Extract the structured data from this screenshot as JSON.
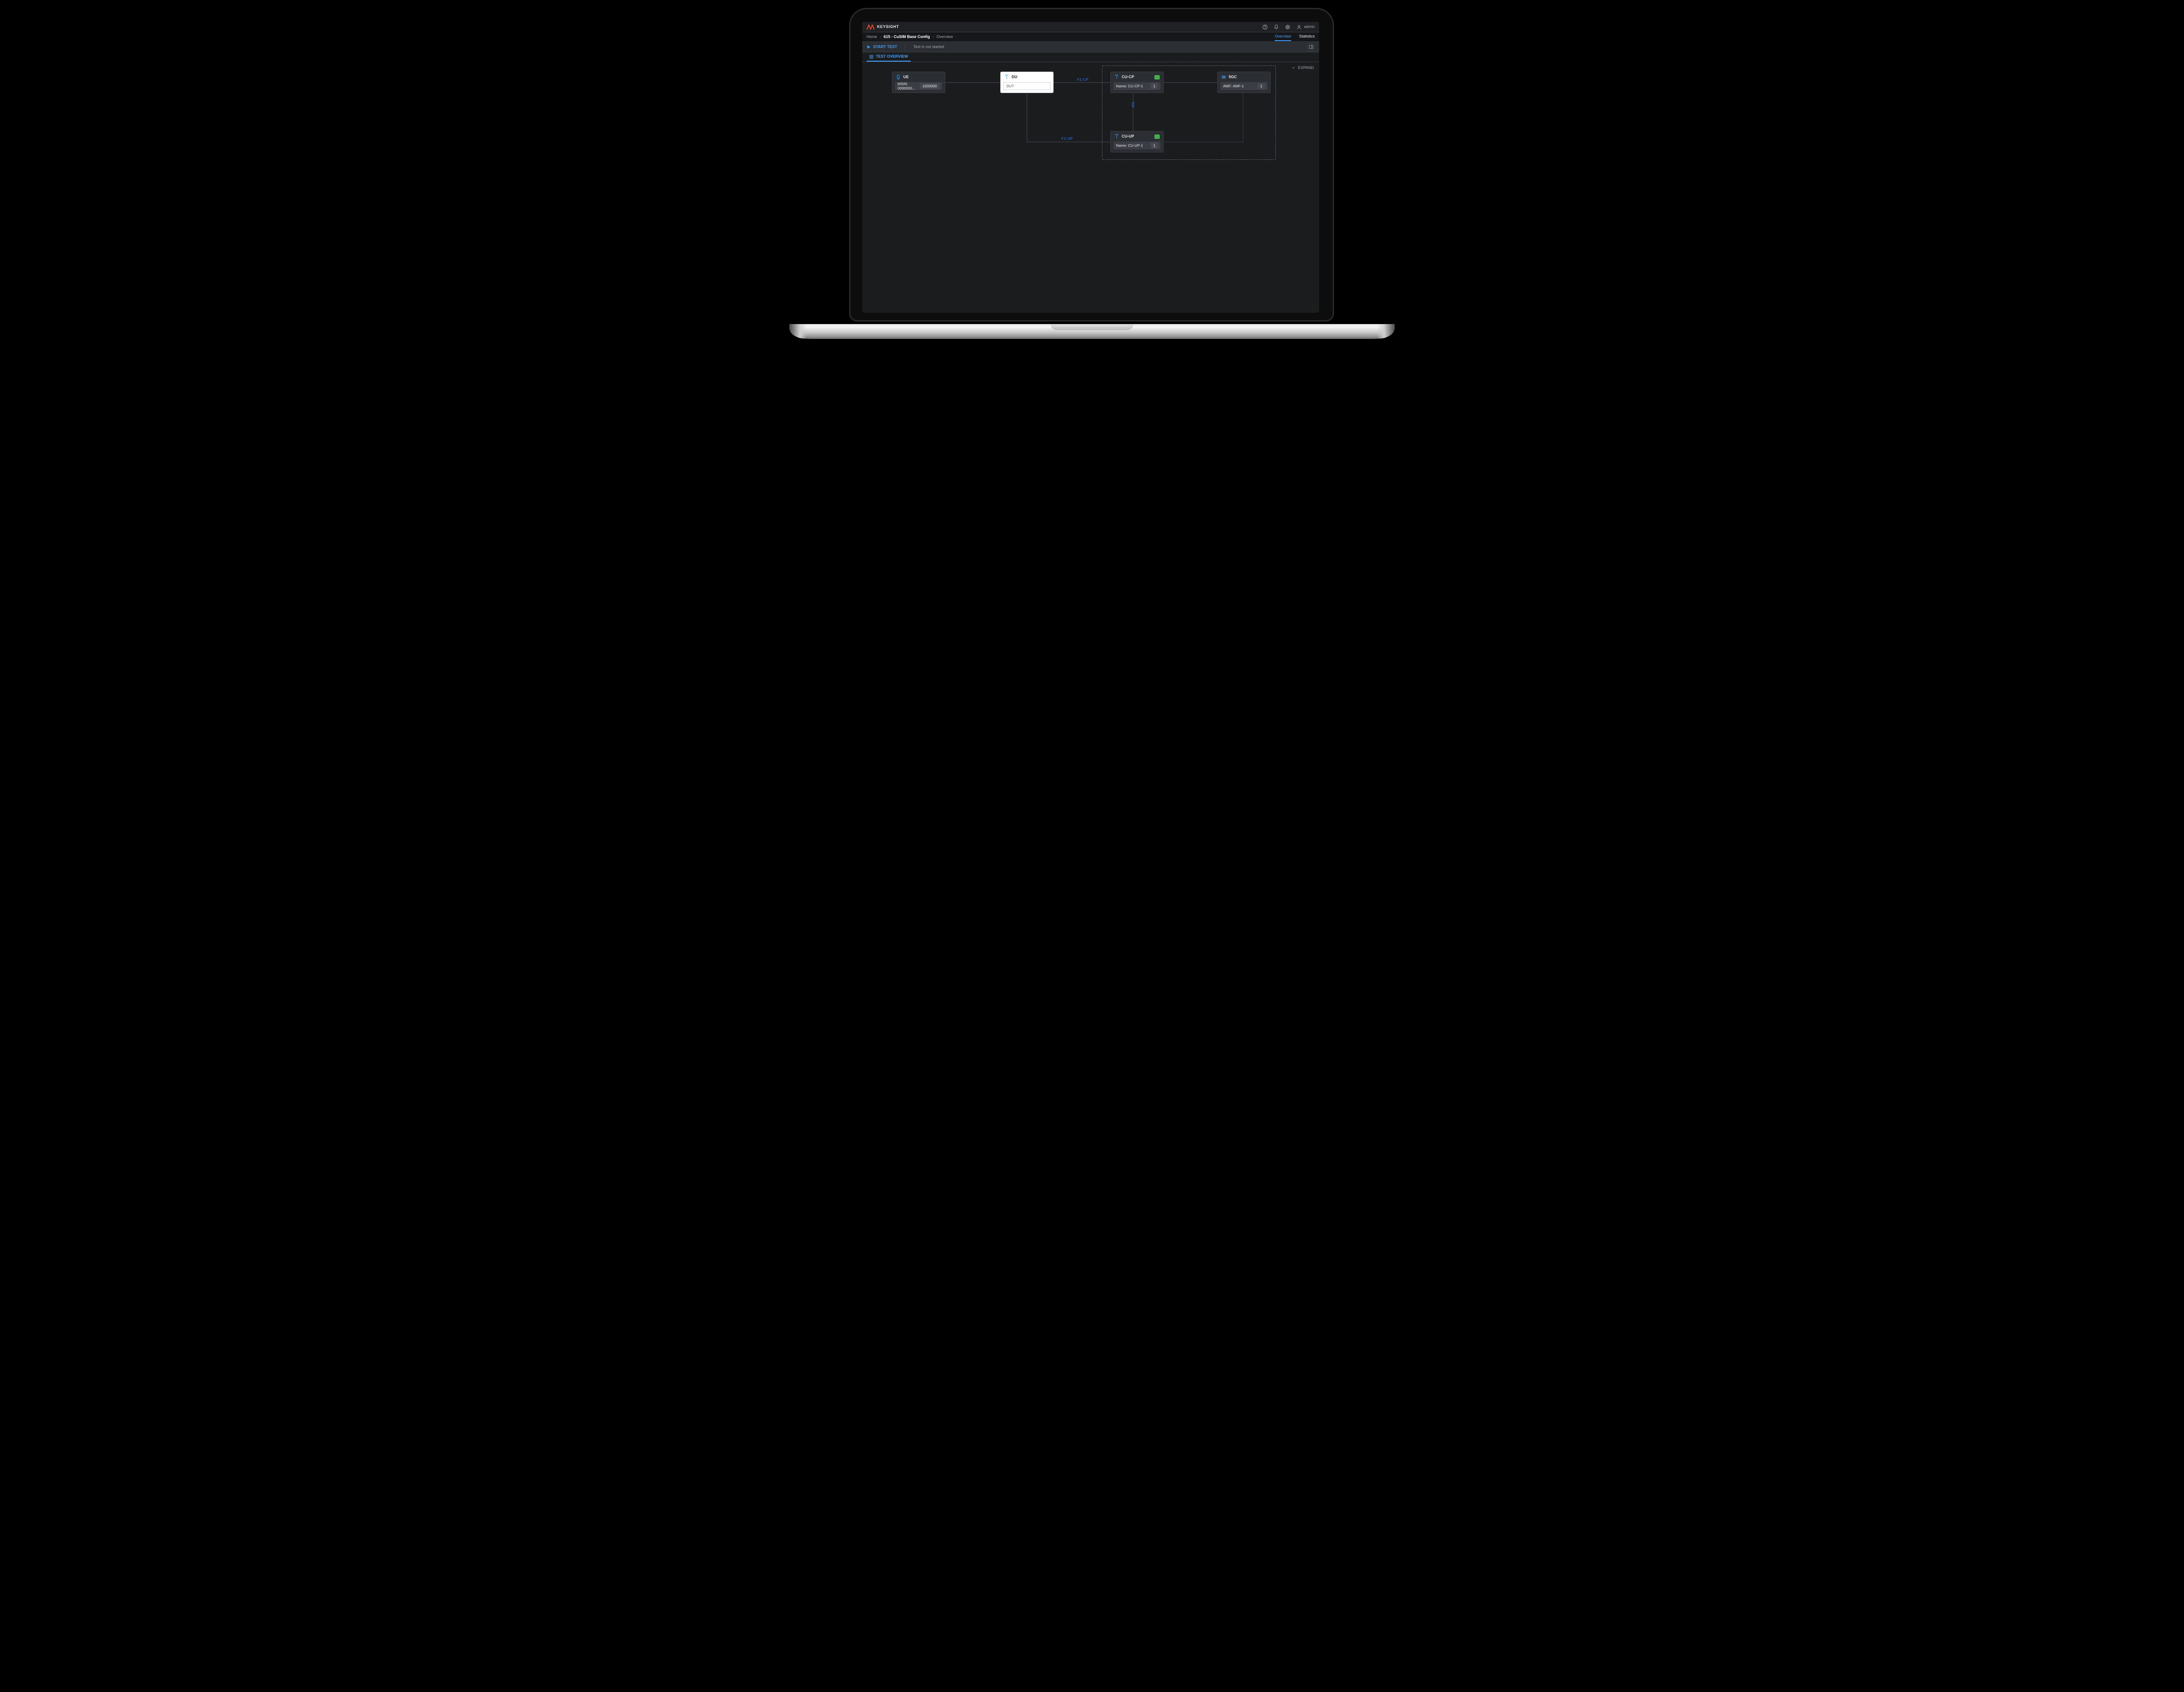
{
  "brand": {
    "name": "KEYSIGHT"
  },
  "header": {
    "icons": {
      "help": "?",
      "notifications": "bell",
      "settings": "gear",
      "user": "user"
    },
    "username": "admin"
  },
  "breadcrumb": {
    "home": "Home",
    "config": "615 - CuSIM Base Config",
    "page": "Overview"
  },
  "navTabs": {
    "overview": "Overview",
    "statistics": "Statistics",
    "active": "overview"
  },
  "toolbar": {
    "start": "START TEST",
    "status": "Test is not started"
  },
  "subtab": {
    "label": "TEST OVERVIEW"
  },
  "expand": {
    "label": "EXPAND"
  },
  "links": {
    "f1cp": "F1-CP",
    "f1up": "F1-UP",
    "xn": "XN"
  },
  "nodes": {
    "ue": {
      "title": "UE",
      "field": "MSIN: 0000000...",
      "value": "1000000"
    },
    "du": {
      "title": "DU",
      "field": "DUT"
    },
    "cucp": {
      "title": "CU-CP",
      "badge": true,
      "field": "Name: CU-CP-1",
      "value": "1"
    },
    "cuup": {
      "title": "CU-UP",
      "badge": true,
      "field": "Name: CU-UP-1",
      "value": "1"
    },
    "fivegc": {
      "title": "5GC",
      "field": "AMF: AMF-1",
      "value": "1"
    }
  }
}
